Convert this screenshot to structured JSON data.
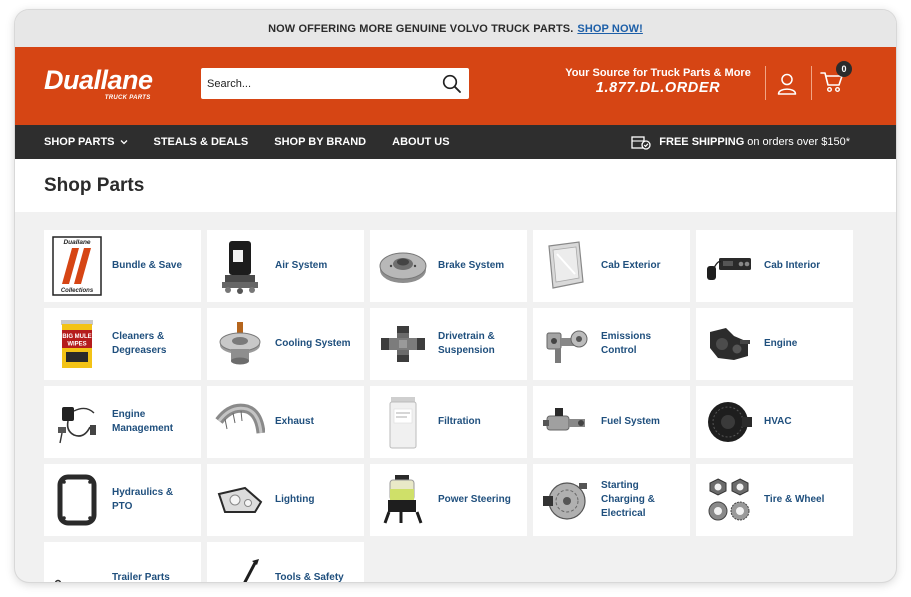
{
  "promo": {
    "text": "NOW OFFERING MORE GENUINE VOLVO TRUCK PARTS.",
    "link": "SHOP NOW!"
  },
  "header": {
    "logo_main": "Duallane",
    "logo_sub": "TRUCK PARTS",
    "search_placeholder": "Search...",
    "tagline": "Your Source for Truck Parts & More",
    "phone": "1.877.DL.ORDER",
    "cart_count": "0",
    "brand_color": "#d64514"
  },
  "nav": {
    "items": [
      "SHOP PARTS",
      "STEALS & DEALS",
      "SHOP BY BRAND",
      "ABOUT US"
    ],
    "shipping_bold": "FREE SHIPPING",
    "shipping_rest": "on orders over $150*"
  },
  "page": {
    "title": "Shop Parts"
  },
  "categories": [
    {
      "label": "Bundle & Save",
      "icon": "duallane-collections-icon",
      "thumb_text": "Duallane",
      "thumb_sub": "Collections"
    },
    {
      "label": "Air System",
      "icon": "air-dryer-icon"
    },
    {
      "label": "Brake System",
      "icon": "brake-rotor-icon"
    },
    {
      "label": "Cab Exterior",
      "icon": "cab-panel-icon"
    },
    {
      "label": "Cab Interior",
      "icon": "cb-radio-icon"
    },
    {
      "label": "Cleaners & Degreasers",
      "icon": "wipes-bucket-icon",
      "thumb_text": "BIG MULE WIPES"
    },
    {
      "label": "Cooling System",
      "icon": "thermostat-icon"
    },
    {
      "label": "Drivetrain & Suspension",
      "icon": "u-joint-icon"
    },
    {
      "label": "Emissions Control",
      "icon": "egr-valve-icon"
    },
    {
      "label": "Engine",
      "icon": "engine-part-icon"
    },
    {
      "label": "Engine Management",
      "icon": "sensor-harness-icon"
    },
    {
      "label": "Exhaust",
      "icon": "exhaust-pipe-icon"
    },
    {
      "label": "Filtration",
      "icon": "filter-icon"
    },
    {
      "label": "Fuel System",
      "icon": "fuel-pump-icon"
    },
    {
      "label": "HVAC",
      "icon": "blower-motor-icon"
    },
    {
      "label": "Hydraulics & PTO",
      "icon": "gasket-icon"
    },
    {
      "label": "Lighting",
      "icon": "headlight-icon"
    },
    {
      "label": "Power Steering",
      "icon": "steering-reservoir-icon"
    },
    {
      "label": "Starting Charging & Electrical",
      "icon": "alternator-icon"
    },
    {
      "label": "Tire & Wheel",
      "icon": "lug-nuts-icon"
    },
    {
      "label": "Trailer Parts",
      "icon": "trailer-hardware-icon"
    },
    {
      "label": "Tools & Safety",
      "icon": "tool-icon"
    }
  ]
}
